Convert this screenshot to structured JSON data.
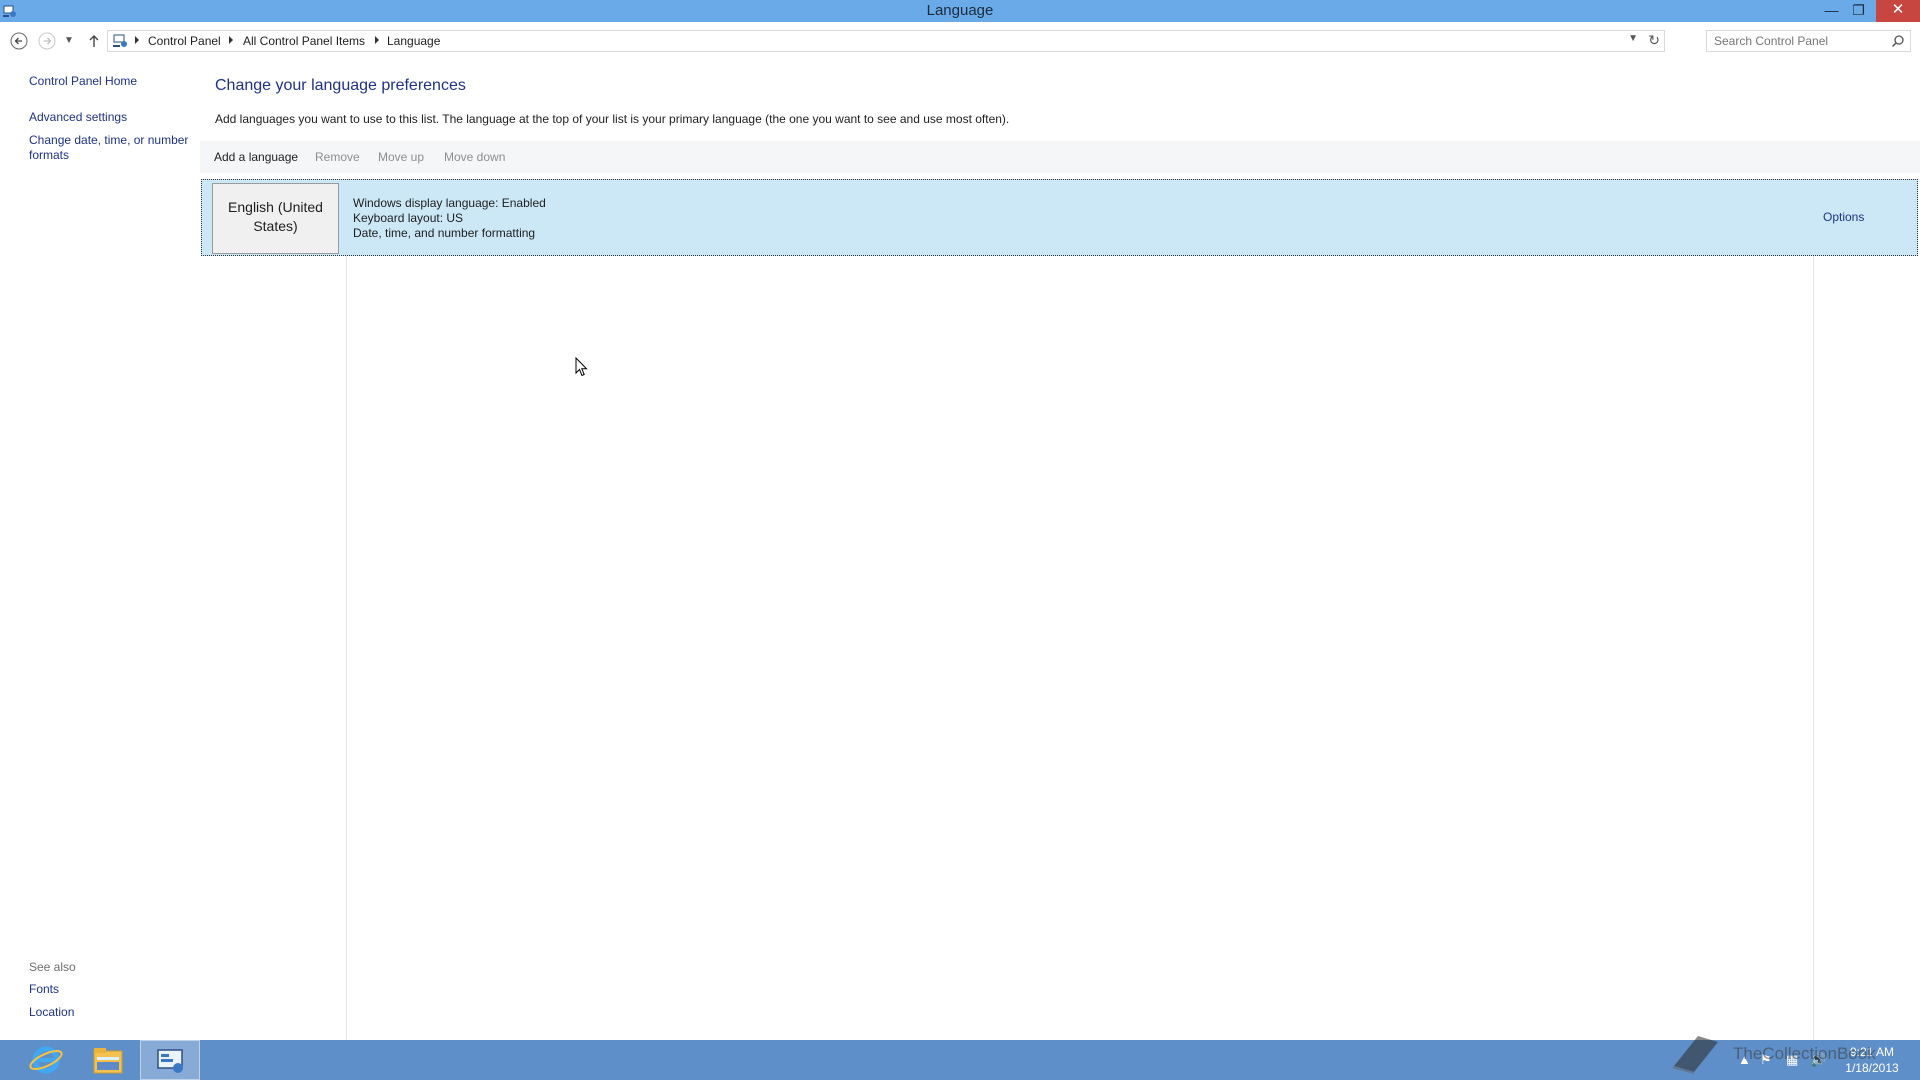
{
  "window": {
    "title": "Language",
    "minimize_icon": "minimize-icon",
    "maximize_icon": "restore-icon",
    "close_icon": "close-icon"
  },
  "nav": {
    "breadcrumb": [
      "Control Panel",
      "All Control Panel Items",
      "Language"
    ],
    "search_placeholder": "Search Control Panel"
  },
  "left_pane": {
    "home": "Control Panel Home",
    "links": [
      "Advanced settings",
      "Change date, time, or number",
      "formats"
    ],
    "see_also_title": "See also",
    "see_also": [
      "Fonts",
      "Location"
    ]
  },
  "main": {
    "heading": "Change your language preferences",
    "description": "Add languages you want to use to this list. The language at the top of your list is your primary language (the one you want to see and use most often).",
    "toolbar": {
      "add": "Add a language",
      "remove": "Remove",
      "move_up": "Move up",
      "move_down": "Move down"
    },
    "languages": [
      {
        "name_line1": "English (United",
        "name_line2": "States)",
        "details": [
          "Windows display language: Enabled",
          "Keyboard layout: US",
          "Date, time, and number formatting"
        ],
        "options": "Options"
      }
    ]
  },
  "taskbar": {
    "apps": [
      "internet-explorer-icon",
      "file-explorer-icon",
      "control-panel-icon"
    ],
    "clock_time": "9:21 AM",
    "clock_date": "1/18/2013",
    "watermark": "TheCollectionBook"
  },
  "colors": {
    "titlebar": "#6aaae9",
    "taskbar": "#5f8fc8",
    "link": "#1e3287",
    "selected_row": "#cce8f6",
    "close_button": "#c7463f"
  }
}
